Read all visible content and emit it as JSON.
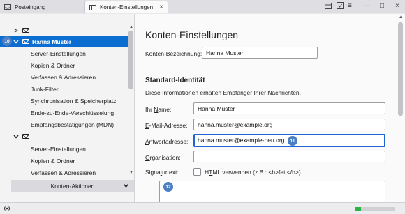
{
  "tabs": [
    {
      "label": "Posteingang",
      "icon": "inbox-icon"
    },
    {
      "label": "Konten-Einstellungen",
      "icon": "settings-icon",
      "close": "×"
    }
  ],
  "window_controls": {
    "calendar": "calendar-icon",
    "tasks": "tasks-icon",
    "menu": "≡",
    "minimize": "—",
    "maximize": "□",
    "close": "×"
  },
  "sidebar": {
    "collapsed_account": {
      "chevron": ">",
      "icon": "mail-icon"
    },
    "account1": {
      "name": "Hanna Muster",
      "items": [
        "Server-Einstellungen",
        "Kopien & Ordner",
        "Verfassen & Adressieren",
        "Junk-Filter",
        "Synchronisation & Speicherplatz",
        "Ende-zu-Ende-Verschlüsselung",
        "Empfangsbestätigungen (MDN)"
      ]
    },
    "account2": {
      "items": [
        "Server-Einstellungen",
        "Kopien & Ordner",
        "Verfassen & Adressieren"
      ]
    },
    "actions_label": "Konten-Aktionen"
  },
  "badges": {
    "b10": "10",
    "b11": "11",
    "b12": "12"
  },
  "main": {
    "title": "Konten-Einstellungen",
    "account_name_label": "Konten-Bezeichnung:",
    "account_name_value": "Hanna Muster",
    "section_title": "Standard-Identität",
    "section_desc": "Diese Informationen erhalten Empfänger Ihrer Nachrichten.",
    "name_label_pre": "Ihr ",
    "name_label_u": "N",
    "name_label_post": "ame:",
    "name_value": "Hanna Muster",
    "email_label_u": "E",
    "email_label_post": "-Mail-Adresse:",
    "email_value": "hanna.muster@example.org",
    "reply_label_u": "A",
    "reply_label_post": "ntwortadresse:",
    "reply_value": "hanna.muster@example-neu.org",
    "org_label_u": "O",
    "org_label_post": "rganisation:",
    "org_value": "",
    "signature_label_pre": "Signa",
    "signature_label_u": "t",
    "signature_label_post": "urtext:",
    "html_label_pre": "H",
    "html_label_u": "T",
    "html_label_post": "ML verwenden (z.B.: <b>fett</b>)"
  },
  "status": {
    "progress_fraction": 0.15
  },
  "colors": {
    "selected": "#0b6dcf",
    "badge": "#4a7fc4",
    "progress": "#2bb34a",
    "focus": "#1d64d4"
  }
}
